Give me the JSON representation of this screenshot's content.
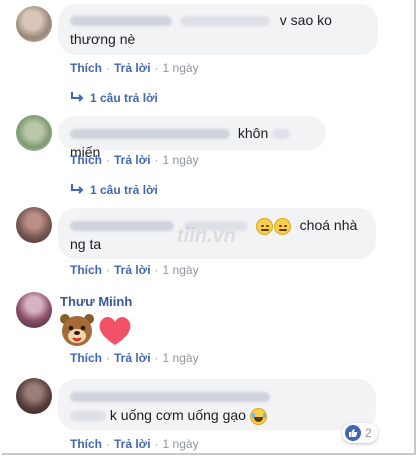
{
  "actions": {
    "like": "Thích",
    "reply": "Trả lời",
    "sep": "·",
    "time": "1 ngày"
  },
  "comments": [
    {
      "text_end": "v sao ko thương nè"
    },
    {
      "text_mid": "khôn",
      "text_end": "miến"
    },
    {
      "text_end": "choá nhà ng ta"
    },
    {
      "name": "Thưư Miinh"
    },
    {
      "text_end": "k uống cơm uống gạo"
    }
  ],
  "reply_link": "1 câu trả lời",
  "reaction_count": "2",
  "watermark": "tiin.vn",
  "colors": {
    "link": "#4267b2",
    "name": "#385898",
    "bubble": "#f2f3f5",
    "meta": "#90949c",
    "heart": "#f25268"
  },
  "icons": [
    "reply-arrow-icon",
    "smile-emoji-icon",
    "laugh-emoji-icon",
    "bear-sticker-icon",
    "heart-sticker-icon",
    "like-reaction-icon"
  ]
}
